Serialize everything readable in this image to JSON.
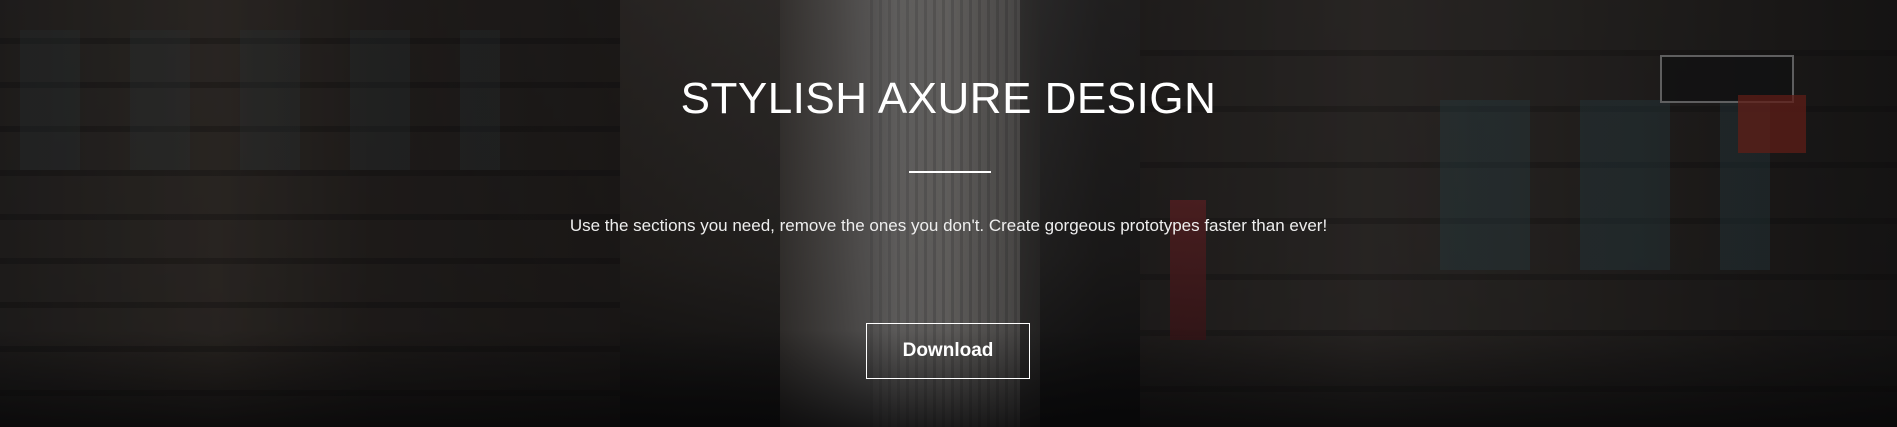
{
  "hero": {
    "title": "STYLISH AXURE DESIGN",
    "subtitle": "Use the sections you need, remove the ones you don't. Create gorgeous prototypes faster than ever!",
    "download_label": "Download",
    "background_image": "city-street-skyscrapers-photo"
  },
  "colors": {
    "text": "#ffffff",
    "button_border": "#ffffff"
  }
}
